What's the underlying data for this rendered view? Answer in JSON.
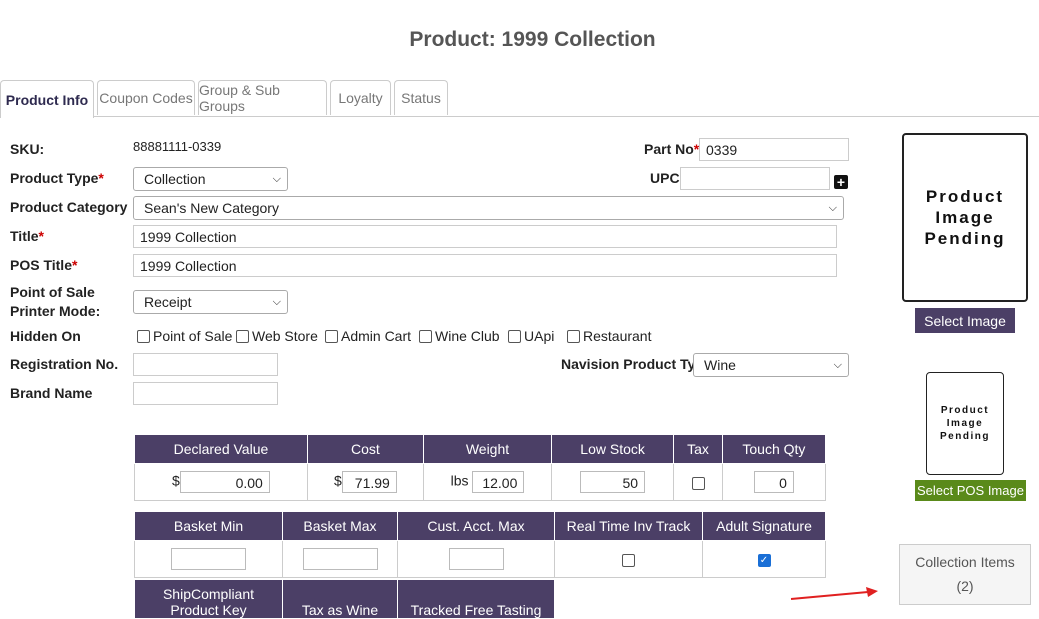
{
  "page_title": "Product: 1999 Collection",
  "tabs": [
    {
      "label": "Product Info",
      "active": true
    },
    {
      "label": "Coupon Codes"
    },
    {
      "label": "Group & Sub Groups"
    },
    {
      "label": "Loyalty"
    },
    {
      "label": "Status"
    }
  ],
  "form": {
    "sku_label": "SKU:",
    "sku_value": "88881111-0339",
    "part_no_label": "Part No",
    "part_no_value": "0339",
    "product_type_label": "Product Type",
    "product_type_value": "Collection",
    "upc_label": "UPC",
    "upc_value": "",
    "product_category_label": "Product Category",
    "product_category_value": "Sean's New Category",
    "title_label": "Title",
    "title_value": "1999 Collection",
    "pos_title_label": "POS Title",
    "pos_title_value": "1999 Collection",
    "pos_printer_label_1": "Point of Sale",
    "pos_printer_label_2": "Printer Mode:",
    "pos_printer_value": "Receipt",
    "hidden_on_label": "Hidden On",
    "hidden_on_options": [
      "Point of Sale",
      "Web Store",
      "Admin Cart",
      "Wine Club",
      "UApi",
      "Restaurant"
    ],
    "registration_label": "Registration No.",
    "registration_value": "",
    "navision_label": "Navision Product Type",
    "navision_value": "Wine",
    "brand_label": "Brand Name",
    "brand_value": "",
    "required_mark": "*"
  },
  "table1": {
    "headers": [
      "Declared Value",
      "Cost",
      "Weight",
      "Low Stock",
      "Tax",
      "Touch Qty"
    ],
    "declared_prefix": "$",
    "declared_value": "0.00",
    "cost_prefix": "$",
    "cost_value": "71.99",
    "weight_prefix": "lbs",
    "weight_value": "12.00",
    "low_stock_value": "50",
    "tax_checked": false,
    "touch_qty_value": "0"
  },
  "table2": {
    "headers": [
      "Basket Min",
      "Basket Max",
      "Cust. Acct. Max",
      "Real Time Inv Track",
      "Adult Signature"
    ],
    "real_time_checked": false,
    "adult_signature_checked": true
  },
  "table3": {
    "header_1_line1": "ShipCompliant",
    "header_1_line2": "Product Key",
    "header_2": "Tax as Wine",
    "header_3": "Tracked Free Tasting"
  },
  "images": {
    "large_placeholder": [
      "Product",
      "Image",
      "Pending"
    ],
    "select_image_label": "Select Image",
    "small_placeholder": [
      "Product",
      "Image",
      "Pending"
    ],
    "select_pos_image_label": "Select POS Image"
  },
  "collection_items": {
    "label": "Collection Items",
    "count": "(2)"
  },
  "colors": {
    "header_purple": "#4b3f66",
    "pos_button_green": "#5a8a1a",
    "required_red": "#cc0000",
    "arrow_red": "#e02020"
  }
}
